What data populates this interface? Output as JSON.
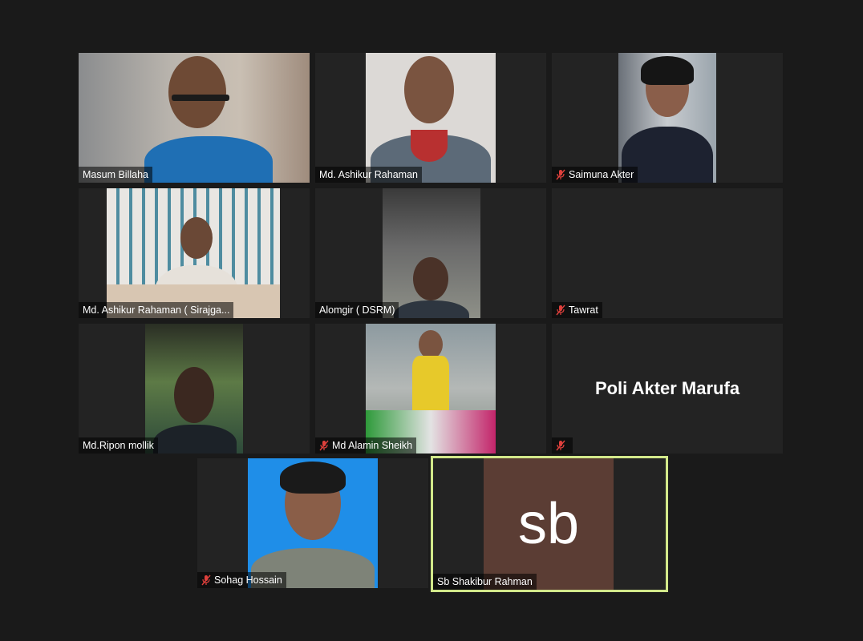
{
  "participants": [
    {
      "name": "Masum Billaha",
      "muted": false
    },
    {
      "name": "Md. Ashikur Rahaman",
      "muted": false
    },
    {
      "name": "Saimuna Akter",
      "muted": true
    },
    {
      "name": "Md. Ashikur Rahaman ( Sirajga...",
      "muted": false
    },
    {
      "name": "Alomgir ( DSRM)",
      "muted": false
    },
    {
      "name": "Tawrat",
      "muted": true
    },
    {
      "name": "Md.Ripon mollik",
      "muted": false
    },
    {
      "name": "Md Alamin Sheikh",
      "muted": true
    },
    {
      "name": "",
      "muted": true,
      "display_name": "Poli Akter Marufa"
    },
    {
      "name": "Sohag Hossain",
      "muted": true
    },
    {
      "name": "Sb Shakibur Rahman",
      "muted": false,
      "avatar_initials": "sb",
      "active_speaker": true
    }
  ],
  "colors": {
    "background": "#1a1a1a",
    "tile": "#232323",
    "active_speaker_border": "#d2e88a",
    "avatar_bg": "#5b3d34",
    "muted_icon": "#e0403c"
  }
}
